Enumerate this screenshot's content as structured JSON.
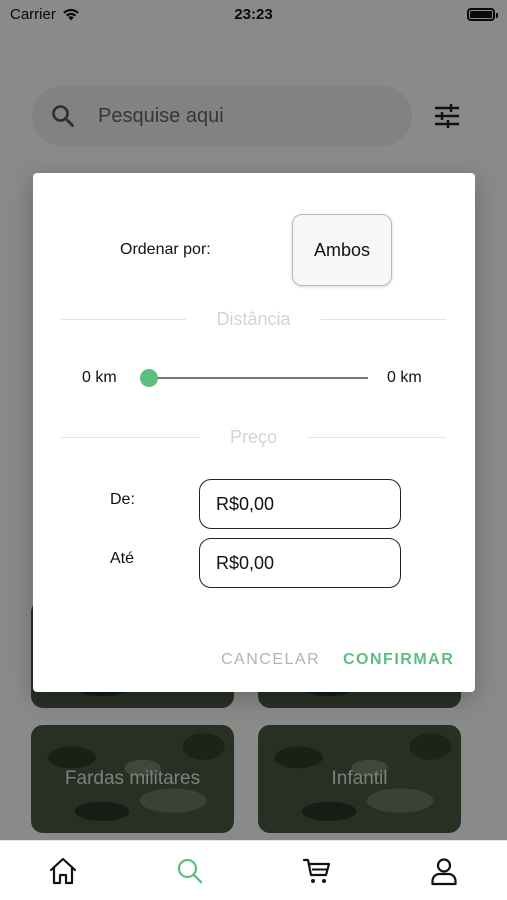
{
  "status_bar": {
    "carrier": "Carrier",
    "time": "23:23",
    "battery_level": 1.0
  },
  "search": {
    "placeholder": "Pesquise aqui",
    "icon": "search-icon",
    "filter_icon": "sliders-icon"
  },
  "categories": [
    {
      "label": "Fardas militares"
    },
    {
      "label": "Infantil"
    }
  ],
  "filter_modal": {
    "order_label": "Ordenar por:",
    "order_value": "Ambos",
    "distance_title": "Distância",
    "distance_min": "0 km",
    "distance_max": "0 km",
    "distance_slider_value": 0,
    "price_title": "Preço",
    "from_label": "De:",
    "from_value": "R$0,00",
    "to_label": "Até",
    "to_value": "R$0,00",
    "cancel_label": "CANCELAR",
    "confirm_label": "CONFIRMAR"
  },
  "colors": {
    "accent": "#5cbf7d",
    "overlay": "rgba(0,0,0,0.46)",
    "muted": "#b3b3b3"
  },
  "bottom_nav": {
    "items": [
      {
        "icon": "home-icon",
        "active": false
      },
      {
        "icon": "search-icon",
        "active": true
      },
      {
        "icon": "cart-icon",
        "active": false
      },
      {
        "icon": "user-icon",
        "active": false
      }
    ]
  }
}
